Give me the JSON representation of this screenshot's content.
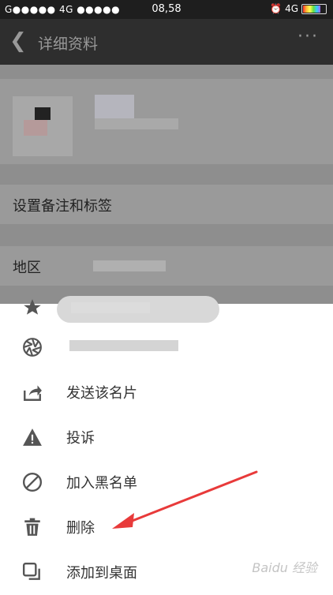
{
  "status_bar": {
    "carrier": "G●●●●● 4G ●●●●●",
    "time": "08,58",
    "network": "4G"
  },
  "nav": {
    "title": "详细资料",
    "more": "···"
  },
  "profile_rows": [
    {
      "label": "设置备注和标签"
    },
    {
      "label": "地区"
    }
  ],
  "menu": [
    {
      "label": "发送该名片",
      "icon": "share-icon"
    },
    {
      "label": "投诉",
      "icon": "warning-icon"
    },
    {
      "label": "加入黑名单",
      "icon": "block-icon"
    },
    {
      "label": "删除",
      "icon": "trash-icon"
    },
    {
      "label": "添加到桌面",
      "icon": "add-to-desktop-icon"
    }
  ],
  "watermark": "Baidu 经验",
  "colors": {
    "annotation_arrow": "#e83a3a"
  }
}
